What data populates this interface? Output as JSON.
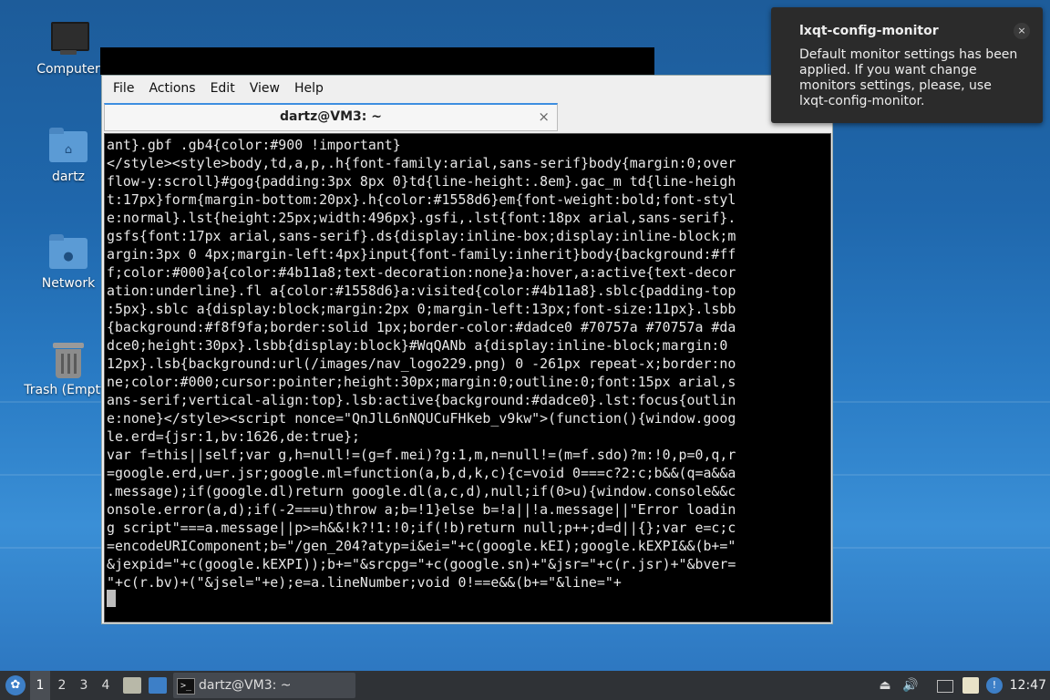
{
  "desktop": {
    "icons": [
      {
        "label": "Computer"
      },
      {
        "label": "dartz"
      },
      {
        "label": "Network"
      },
      {
        "label": "Trash (Empty)"
      }
    ]
  },
  "terminal": {
    "menu": [
      "File",
      "Actions",
      "Edit",
      "View",
      "Help"
    ],
    "tab_title": "dartz@VM3: ~",
    "tab_close": "×",
    "lines": [
      "ant}.gbf .gb4{color:#900 !important}",
      "</style><style>body,td,a,p,.h{font-family:arial,sans-serif}body{margin:0;over",
      "flow-y:scroll}#gog{padding:3px 8px 0}td{line-height:.8em}.gac_m td{line-heigh",
      "t:17px}form{margin-bottom:20px}.h{color:#1558d6}em{font-weight:bold;font-styl",
      "e:normal}.lst{height:25px;width:496px}.gsfi,.lst{font:18px arial,sans-serif}.",
      "gsfs{font:17px arial,sans-serif}.ds{display:inline-box;display:inline-block;m",
      "argin:3px 0 4px;margin-left:4px}input{font-family:inherit}body{background:#ff",
      "f;color:#000}a{color:#4b11a8;text-decoration:none}a:hover,a:active{text-decor",
      "ation:underline}.fl a{color:#1558d6}a:visited{color:#4b11a8}.sblc{padding-top",
      ":5px}.sblc a{display:block;margin:2px 0;margin-left:13px;font-size:11px}.lsbb",
      "{background:#f8f9fa;border:solid 1px;border-color:#dadce0 #70757a #70757a #da",
      "dce0;height:30px}.lsbb{display:block}#WqQANb a{display:inline-block;margin:0 ",
      "12px}.lsb{background:url(/images/nav_logo229.png) 0 -261px repeat-x;border:no",
      "ne;color:#000;cursor:pointer;height:30px;margin:0;outline:0;font:15px arial,s",
      "ans-serif;vertical-align:top}.lsb:active{background:#dadce0}.lst:focus{outlin",
      "e:none}</style><script nonce=\"QnJlL6nNQUCuFHkeb_v9kw\">(function(){window.goog",
      "le.erd={jsr:1,bv:1626,de:true};",
      "var f=this||self;var g,h=null!=(g=f.mei)?g:1,m,n=null!=(m=f.sdo)?m:!0,p=0,q,r",
      "=google.erd,u=r.jsr;google.ml=function(a,b,d,k,c){c=void 0===c?2:c;b&&(q=a&&a",
      ".message);if(google.dl)return google.dl(a,c,d),null;if(0>u){window.console&&c",
      "onsole.error(a,d);if(-2===u)throw a;b=!1}else b=!a||!a.message||\"Error loadin",
      "g script\"===a.message||p>=h&&!k?!1:!0;if(!b)return null;p++;d=d||{};var e=c;c",
      "=encodeURIComponent;b=\"/gen_204?atyp=i&ei=\"+c(google.kEI);google.kEXPI&&(b+=\"",
      "&jexpid=\"+c(google.kEXPI));b+=\"&srcpg=\"+c(google.sn)+\"&jsr=\"+c(r.jsr)+\"&bver=",
      "\"+c(r.bv)+(\"&jsel=\"+e);e=a.lineNumber;void 0!==e&&(b+=\"&line=\"+"
    ]
  },
  "notification": {
    "title": "lxqt-config-monitor",
    "body": "Default monitor settings has been applied. If you want change monitors settings, please, use lxqt-config-monitor.",
    "close": "×"
  },
  "taskbar": {
    "workspaces": [
      "1",
      "2",
      "3",
      "4"
    ],
    "active_workspace": "1",
    "task_label": "dartz@VM3: ~",
    "clock": "12:47"
  }
}
